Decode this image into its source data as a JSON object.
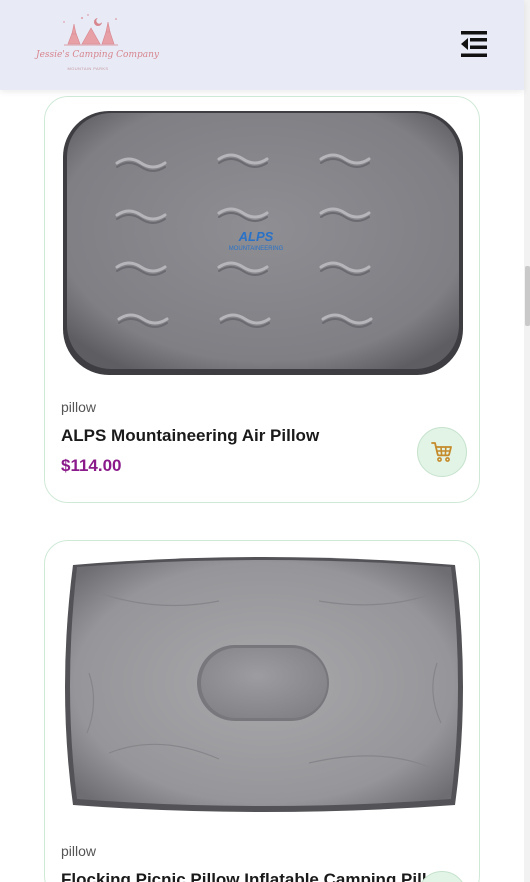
{
  "brand": {
    "name": "Jessie's Camping Company",
    "tagline": "MOUNTAIN PARKS"
  },
  "header": {
    "menu_icon": "menu-fold-icon"
  },
  "products": [
    {
      "category": "pillow",
      "title": "ALPS Mountaineering Air Pillow",
      "price": "$114.00",
      "image_text": "ALPS",
      "image_subtext": "MOUNTAINEERING"
    },
    {
      "category": "pillow",
      "title": "Flocking Picnic Pillow Inflatable Camping Pillow",
      "price": ""
    }
  ],
  "colors": {
    "header_bg": "#e8eaf6",
    "price": "#8b1a8a",
    "card_border": "#cfe9d7",
    "cart_bg": "#e2f4e6",
    "cart_icon": "#c58a2a",
    "logo": "#d7868e"
  }
}
